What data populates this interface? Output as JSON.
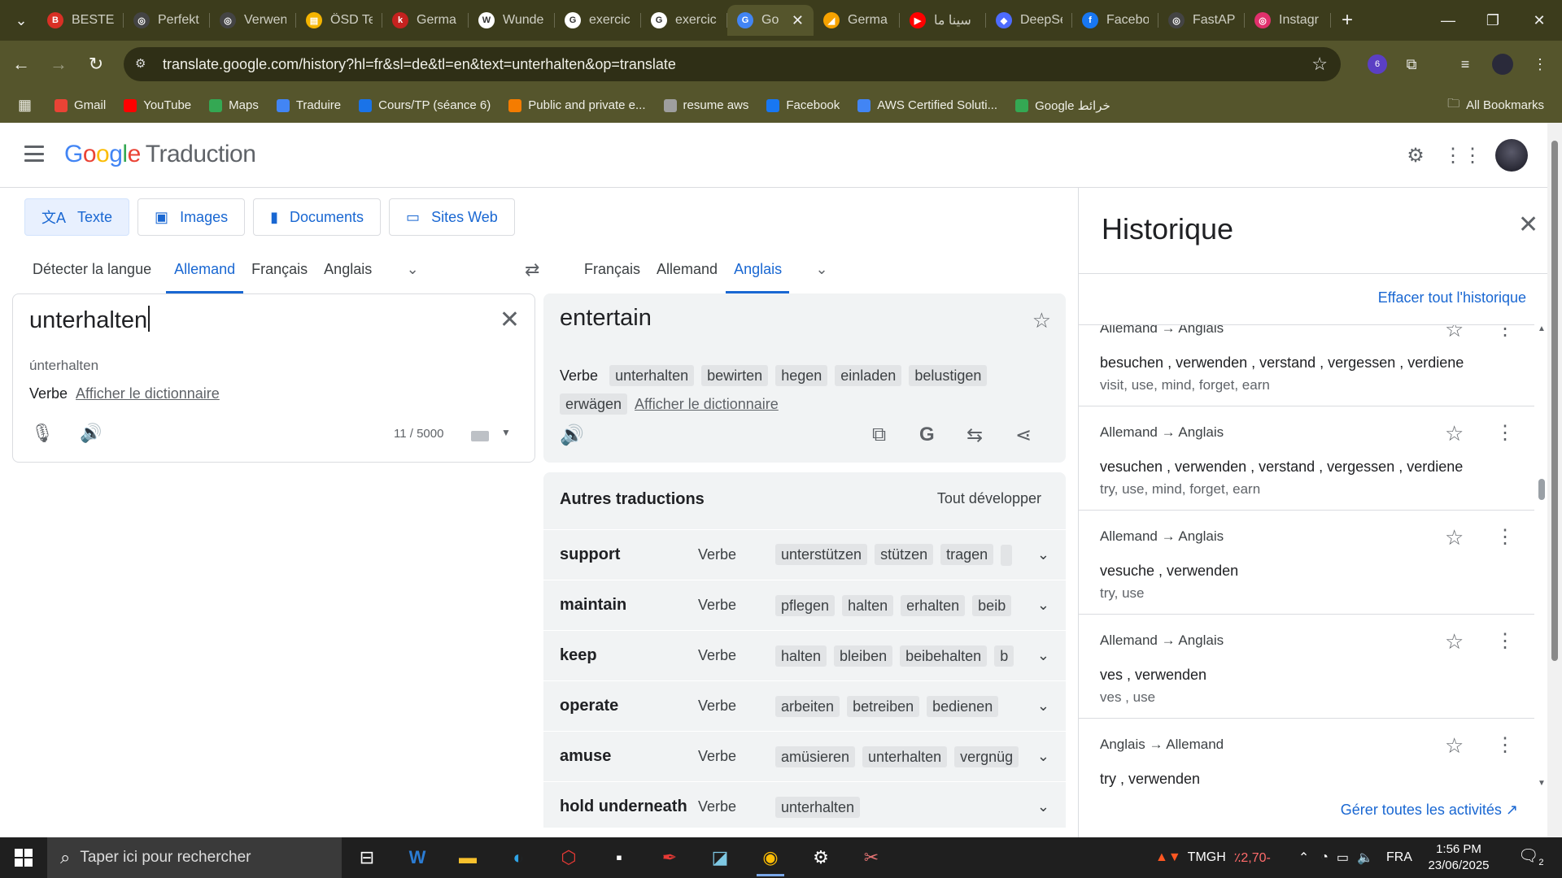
{
  "browser": {
    "tabs": [
      {
        "label": "BESTEH",
        "fav": "B",
        "color": "#d93025"
      },
      {
        "label": "Perfekt",
        "fav": "◎",
        "color": "#444"
      },
      {
        "label": "Verwen",
        "fav": "◎",
        "color": "#444"
      },
      {
        "label": "ÖSD Te",
        "fav": "▤",
        "color": "#f4b400"
      },
      {
        "label": "Germa",
        "fav": "k",
        "color": "#c5221f"
      },
      {
        "label": "Wunde",
        "fav": "W",
        "color": "#fff"
      },
      {
        "label": "exercic",
        "fav": "G",
        "color": "#fff"
      },
      {
        "label": "exercic",
        "fav": "G",
        "color": "#fff"
      },
      {
        "label": "Go",
        "fav": "G",
        "color": "#4285f4"
      },
      {
        "label": "Germa",
        "fav": "◢",
        "color": "#f6a200"
      },
      {
        "label": "سينا ما",
        "fav": "▶",
        "color": "#ff0000"
      },
      {
        "label": "DeepSe",
        "fav": "◆",
        "color": "#4d6bfe"
      },
      {
        "label": "Facebo",
        "fav": "f",
        "color": "#1877f2"
      },
      {
        "label": "FastAPI",
        "fav": "◎",
        "color": "#444"
      },
      {
        "label": "Instagr",
        "fav": "◎",
        "color": "#e1306c"
      }
    ],
    "url": "translate.google.com/history?hl=fr&sl=de&tl=en&text=unterhalten&op=translate",
    "extensions_badge": "6",
    "bookmarks": [
      {
        "label": "Gmail",
        "color": "#ea4335"
      },
      {
        "label": "YouTube",
        "color": "#ff0000"
      },
      {
        "label": "Maps",
        "color": "#34a853"
      },
      {
        "label": "Traduire",
        "color": "#4285f4"
      },
      {
        "label": "Cours/TP (séance 6)",
        "color": "#1a73e8"
      },
      {
        "label": "Public and private e...",
        "color": "#f57c00"
      },
      {
        "label": "resume aws",
        "color": "#9e9e9e"
      },
      {
        "label": "Facebook",
        "color": "#1877f2"
      },
      {
        "label": "AWS Certified Soluti...",
        "color": "#4285f4"
      },
      {
        "label": "Google خرائط",
        "color": "#34a853"
      }
    ],
    "all_bookmarks": "All Bookmarks"
  },
  "app": {
    "logo_google": "Google",
    "logo_product": "Traduction",
    "modes": [
      "Texte",
      "Images",
      "Documents",
      "Sites Web"
    ],
    "source_langs": [
      "Détecter la langue",
      "Allemand",
      "Français",
      "Anglais"
    ],
    "target_langs": [
      "Français",
      "Allemand",
      "Anglais"
    ]
  },
  "source": {
    "text": "unterhalten",
    "translit": "únterhalten",
    "pos": "Verbe",
    "dict_link": "Afficher le dictionnaire",
    "count": "11 / 5000"
  },
  "target": {
    "text": "entertain",
    "pos": "Verbe",
    "alts": [
      "unterhalten",
      "bewirten",
      "hegen",
      "einladen",
      "belustigen",
      "erwägen"
    ],
    "dict_link": "Afficher le dictionnaire"
  },
  "other": {
    "title": "Autres traductions",
    "expand_all": "Tout développer",
    "rows": [
      {
        "word": "support",
        "pos": "Verbe",
        "chips": [
          "unterstützen",
          "stützen",
          "tragen",
          ""
        ]
      },
      {
        "word": "maintain",
        "pos": "Verbe",
        "chips": [
          "pflegen",
          "halten",
          "erhalten",
          "beib"
        ]
      },
      {
        "word": "keep",
        "pos": "Verbe",
        "chips": [
          "halten",
          "bleiben",
          "beibehalten",
          "b"
        ]
      },
      {
        "word": "operate",
        "pos": "Verbe",
        "chips": [
          "arbeiten",
          "betreiben",
          "bedienen"
        ]
      },
      {
        "word": "amuse",
        "pos": "Verbe",
        "chips": [
          "amüsieren",
          "unterhalten",
          "vergnüg"
        ]
      },
      {
        "word": "hold underneath",
        "pos": "Verbe",
        "chips": [
          "unterhalten"
        ]
      }
    ]
  },
  "history": {
    "title": "Historique",
    "clear_all": "Effacer tout l'historique",
    "manage": "Gérer toutes les activités",
    "items": [
      {
        "dir": "Allemand → Anglais",
        "src": "besuchen , verwenden , verstand , vergessen , verdiene",
        "tgt": "visit, use, mind, forget, earn"
      },
      {
        "dir": "Allemand → Anglais",
        "src": "vesuchen , verwenden , verstand , vergessen , verdiene",
        "tgt": "try, use, mind, forget, earn"
      },
      {
        "dir": "Allemand → Anglais",
        "src": "vesuche , verwenden",
        "tgt": "try, use"
      },
      {
        "dir": "Allemand → Anglais",
        "src": "ves , verwenden",
        "tgt": "ves , use"
      },
      {
        "dir": "Anglais → Allemand",
        "src": "try , verwenden",
        "tgt": ""
      }
    ]
  },
  "taskbar": {
    "search_placeholder": "Taper ici pour rechercher",
    "stock": "TMGH",
    "stock_change": "٪2,70-",
    "lang": "FRA",
    "time": "1:56 PM",
    "date": "23/06/2025",
    "notif_count": "2"
  }
}
